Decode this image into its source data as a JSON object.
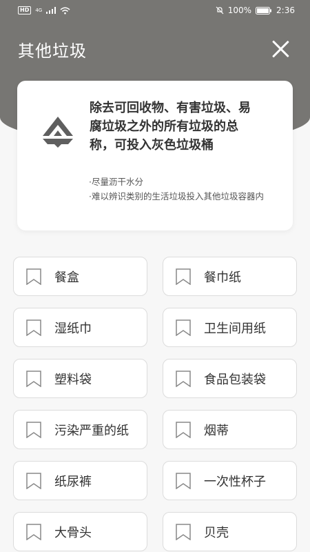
{
  "status_bar": {
    "hd": "HD",
    "network": "4G",
    "battery": "100%",
    "time": "2:36"
  },
  "header": {
    "title": "其他垃圾",
    "bg_color": "#777673"
  },
  "info_card": {
    "description": "除去可回收物、有害垃圾、易腐垃圾之外的所有垃圾的总称，可投入灰色垃圾桶",
    "tips": [
      "·尽量沥干水分",
      "·难以辨识类别的生活垃圾投入其他垃圾容器内"
    ]
  },
  "items": [
    {
      "label": "餐盒",
      "icon": "bookmark-icon"
    },
    {
      "label": "餐巾纸",
      "icon": "bookmark-icon"
    },
    {
      "label": "湿纸巾",
      "icon": "bookmark-icon"
    },
    {
      "label": "卫生间用纸",
      "icon": "bookmark-icon"
    },
    {
      "label": "塑料袋",
      "icon": "bookmark-icon"
    },
    {
      "label": "食品包装袋",
      "icon": "bookmark-icon"
    },
    {
      "label": "污染严重的纸",
      "icon": "bookmark-icon"
    },
    {
      "label": "烟蒂",
      "icon": "bookmark-icon"
    },
    {
      "label": "纸尿裤",
      "icon": "bookmark-icon"
    },
    {
      "label": "一次性杯子",
      "icon": "bookmark-icon"
    },
    {
      "label": "大骨头",
      "icon": "bookmark-icon"
    },
    {
      "label": "贝壳",
      "icon": "bookmark-icon"
    }
  ]
}
